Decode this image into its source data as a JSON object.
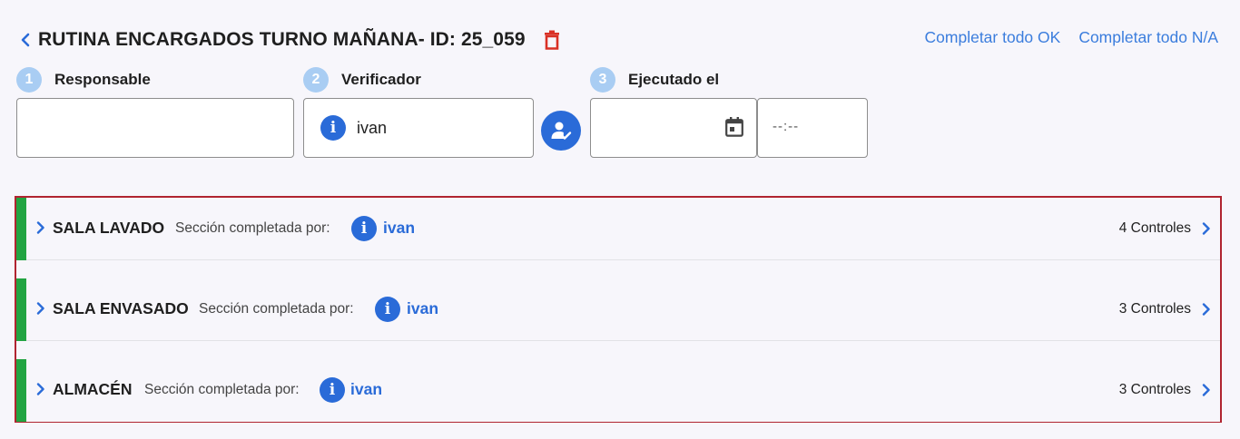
{
  "header": {
    "back_icon": "chevron-left-icon",
    "title": "RUTINA ENCARGADOS TURNO MAÑANA- ID: 25_059",
    "delete_icon": "trash-icon"
  },
  "actions": {
    "complete_ok": "Completar todo OK",
    "complete_na": "Completar todo N/A"
  },
  "steps": [
    {
      "num": "1",
      "label": "Responsable"
    },
    {
      "num": "2",
      "label": "Verificador"
    },
    {
      "num": "3",
      "label": "Ejecutado el"
    }
  ],
  "fields": {
    "responsable_value": "",
    "verificador_name": "ivan",
    "info_glyph": "i",
    "date_value": "",
    "time_value": "--:--"
  },
  "sections": [
    {
      "name": "SALA LAVADO",
      "completed_by_label": "Sección completada por:",
      "user": "ivan",
      "controls": "4 Controles"
    },
    {
      "name": "SALA ENVASADO",
      "completed_by_label": "Sección completada por:",
      "user": "ivan",
      "controls": "3 Controles"
    },
    {
      "name": "ALMACÉN",
      "completed_by_label": "Sección completada por:",
      "user": "ivan",
      "controls": "3 Controles"
    }
  ],
  "colors": {
    "accent": "#2a6bd8",
    "link": "#3b7ddd",
    "status_complete": "#22a442",
    "delete": "#d93025",
    "highlight_border": "#b02430",
    "step_badge": "#a9cdf3"
  }
}
